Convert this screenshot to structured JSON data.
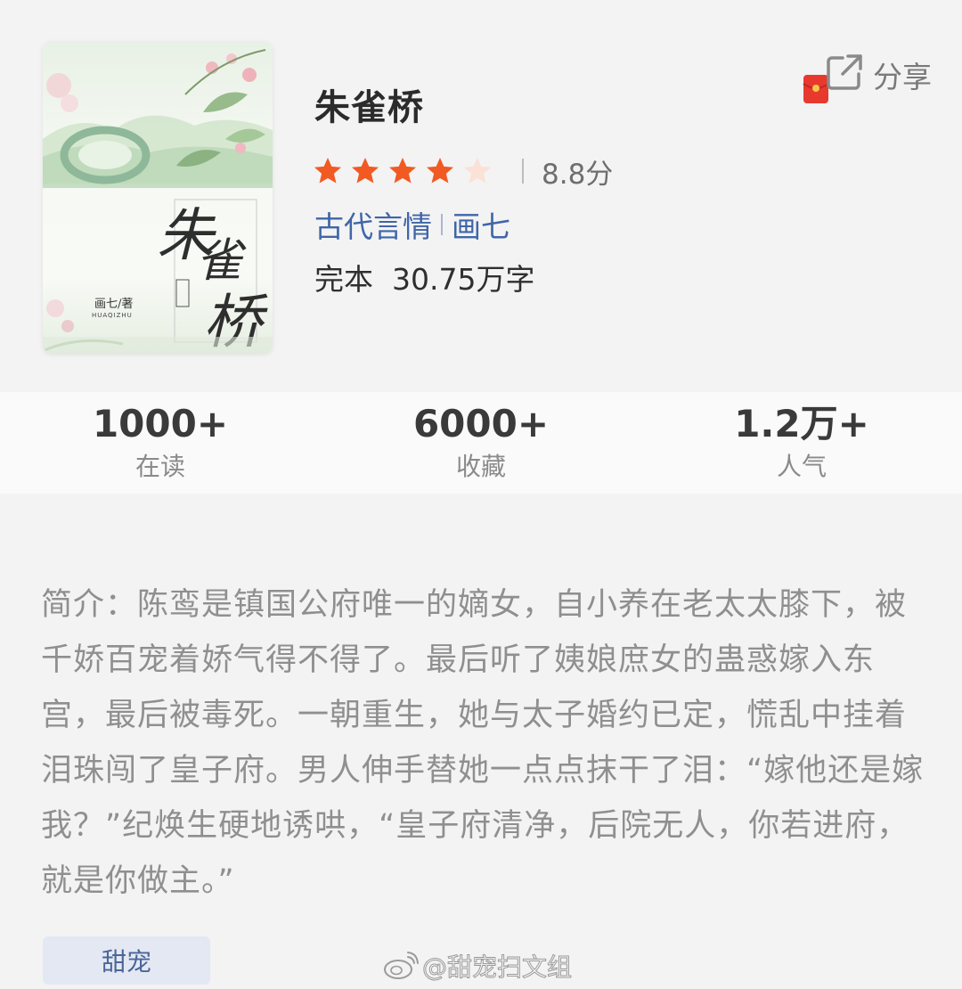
{
  "book": {
    "title": "朱雀桥",
    "rating_stars": 4,
    "rating_max": 5,
    "score": "8.8分",
    "genre": "古代言情",
    "author": "画七",
    "status_and_length": "完本  30.75万字"
  },
  "cover": {
    "title_calligraphy": [
      "朱",
      "雀",
      "桥"
    ],
    "author_label": "画七/著",
    "author_pinyin": "HUAQIZHU"
  },
  "share": {
    "label": "分享",
    "icon": "share-external-icon",
    "envelope_icon": "red-envelope-icon"
  },
  "stats": [
    {
      "value": "1000+",
      "label": "在读"
    },
    {
      "value": "6000+",
      "label": "收藏"
    },
    {
      "value": "1.2万+",
      "label": "人气"
    }
  ],
  "synopsis": "简介：陈鸾是镇国公府唯一的嫡女，自小养在老太太膝下，被千娇百宠着娇气得不得了。最后听了姨娘庶女的蛊惑嫁入东宫，最后被毒死。一朝重生，她与太子婚约已定，慌乱中挂着泪珠闯了皇子府。男人伸手替她一点点抹干了泪：“嫁他还是嫁我？”纪焕生硬地诱哄，“皇子府清净，后院无人，你若进府，就是你做主。”",
  "tag": "甜宠",
  "watermark": "@甜宠扫文组",
  "colors": {
    "star_filled": "#f15a22",
    "star_empty": "#fbe1d6",
    "link_blue": "#3f66a8",
    "tag_bg": "#e3e8f3"
  }
}
